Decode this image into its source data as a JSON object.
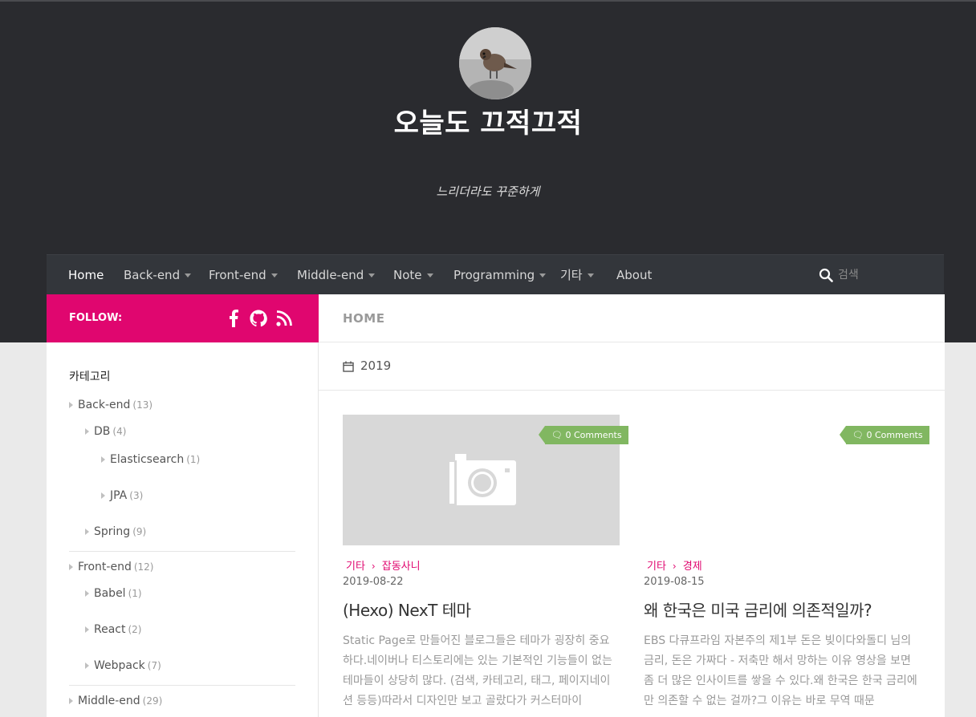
{
  "site": {
    "title": "오늘도 끄적끄적",
    "description": "느리더라도 꾸준하게"
  },
  "nav": {
    "items": [
      {
        "label": "Home",
        "dropdown": false,
        "active": true
      },
      {
        "label": "Back-end",
        "dropdown": true
      },
      {
        "label": "Front-end",
        "dropdown": true
      },
      {
        "label": "Middle-end",
        "dropdown": true
      },
      {
        "label": "Note",
        "dropdown": true
      },
      {
        "label": "Programming",
        "dropdown": true
      },
      {
        "label": "기타",
        "dropdown": true
      },
      {
        "label": "About",
        "dropdown": false
      }
    ],
    "search_placeholder": "검색"
  },
  "follow": {
    "label": "FOLLOW:",
    "icons": [
      "facebook-icon",
      "github-icon",
      "rss-icon"
    ]
  },
  "sidebar": {
    "title": "카테고리",
    "categories": [
      {
        "label": "Back-end",
        "count": "(13)"
      },
      {
        "label": "DB",
        "count": "(4)"
      },
      {
        "label": "Elasticsearch",
        "count": "(1)"
      },
      {
        "label": "JPA",
        "count": "(3)"
      },
      {
        "label": "Spring",
        "count": "(9)"
      },
      {
        "label": "Front-end",
        "count": "(12)"
      },
      {
        "label": "Babel",
        "count": "(1)"
      },
      {
        "label": "React",
        "count": "(2)"
      },
      {
        "label": "Webpack",
        "count": "(7)"
      },
      {
        "label": "Middle-end",
        "count": "(29)"
      }
    ]
  },
  "main": {
    "heading": "HOME",
    "year": "2019",
    "posts": [
      {
        "comments": "0 Comments",
        "category": "기타",
        "subcategory": "잡동사니",
        "date": "2019-08-22",
        "title": "(Hexo) NexT 테마",
        "excerpt": "Static Page로 만들어진 블로그들은 테마가 굉장히 중요하다.네이버나 티스토리에는 있는 기본적인 기능들이 없는 테마들이 상당히 많다. (검색, 카테고리, 태그, 페이지네이션 등등)따라서 디자인만 보고 골랐다가 커스터마이"
      },
      {
        "comments": "0 Comments",
        "category": "기타",
        "subcategory": "경제",
        "date": "2019-08-15",
        "title": "왜 한국은 미국 금리에 의존적일까?",
        "excerpt": "EBS 다큐프라임 자본주의 제1부 돈은 빚이다와돌디 님의 금리, 돈은 가짜다 - 저축만 해서 망하는 이유 영상을 보면 좀 더 많은 인사이트를 쌓을 수 있다.왜 한국은 한국 금리에만 의존할 수 없는 걸까?그 이유는 바로 무역 때문"
      }
    ]
  },
  "colors": {
    "accent": "#e0066f",
    "header_bg": "#2a2b2f",
    "nav_bg": "#33363b",
    "comments_badge": "#81b761"
  }
}
